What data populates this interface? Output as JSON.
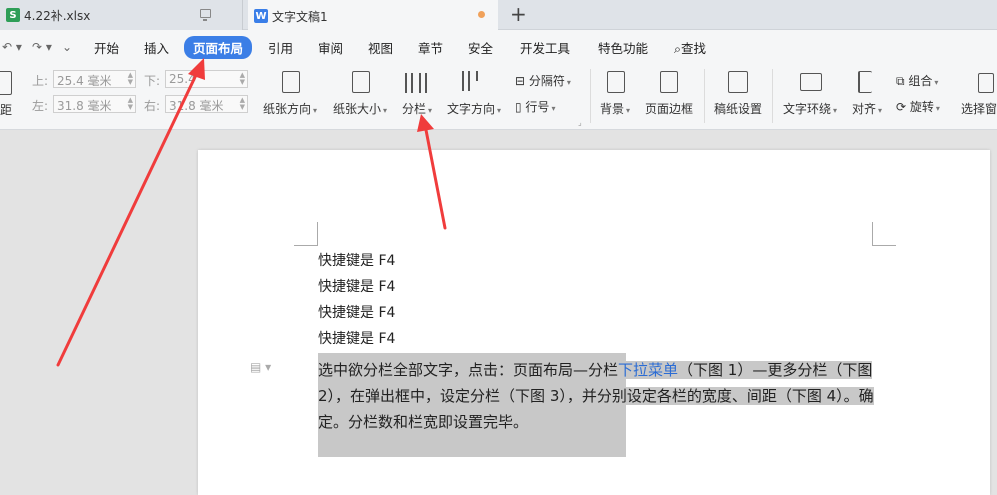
{
  "tabs": [
    {
      "label": "4.22补.xlsx",
      "icon": "S"
    },
    {
      "label": "文字文稿1",
      "icon": "W"
    }
  ],
  "menu": {
    "items": [
      "开始",
      "插入",
      "页面布局",
      "引用",
      "审阅",
      "视图",
      "章节",
      "安全",
      "开发工具",
      "特色功能"
    ],
    "search": "查找",
    "active": "页面布局"
  },
  "ribbon": {
    "margins": {
      "top_label": "上:",
      "top_value": "25.4 毫米",
      "bottom_label": "下:",
      "bottom_value": "25.4",
      "left_label": "左:",
      "left_value": "31.8 毫米",
      "right_label": "右:",
      "right_value": "31.8 毫米",
      "prefix": "距"
    },
    "buttons": {
      "orientation": "纸张方向",
      "size": "纸张大小",
      "columns": "分栏",
      "text_direction": "文字方向",
      "separator": "分隔符",
      "line_number": "行号",
      "background": "背景",
      "page_border": "页面边框",
      "manuscript": "稿纸设置",
      "wrap": "文字环绕",
      "align": "对齐",
      "group": "组合",
      "rotate": "旋转",
      "select_pane": "选择窗"
    }
  },
  "document": {
    "lines": [
      "快捷键是 F4",
      "快捷键是 F4",
      "快捷键是 F4",
      "快捷键是 F4"
    ],
    "para_part1": "选中欲分栏全部文字，点击：页面布局—分栏",
    "para_link": "下拉菜单",
    "para_part2": "（下图 1）—更多分栏（下图 2），在弹出框中，设定分栏（下图 3），并分别设定各栏的宽度、间距（下图 4）。确定。分栏数和栏宽即设置完毕。"
  },
  "colors": {
    "accent": "#3b7ee6",
    "arrow": "#f03c3c",
    "selection": "#c8c8c8"
  }
}
